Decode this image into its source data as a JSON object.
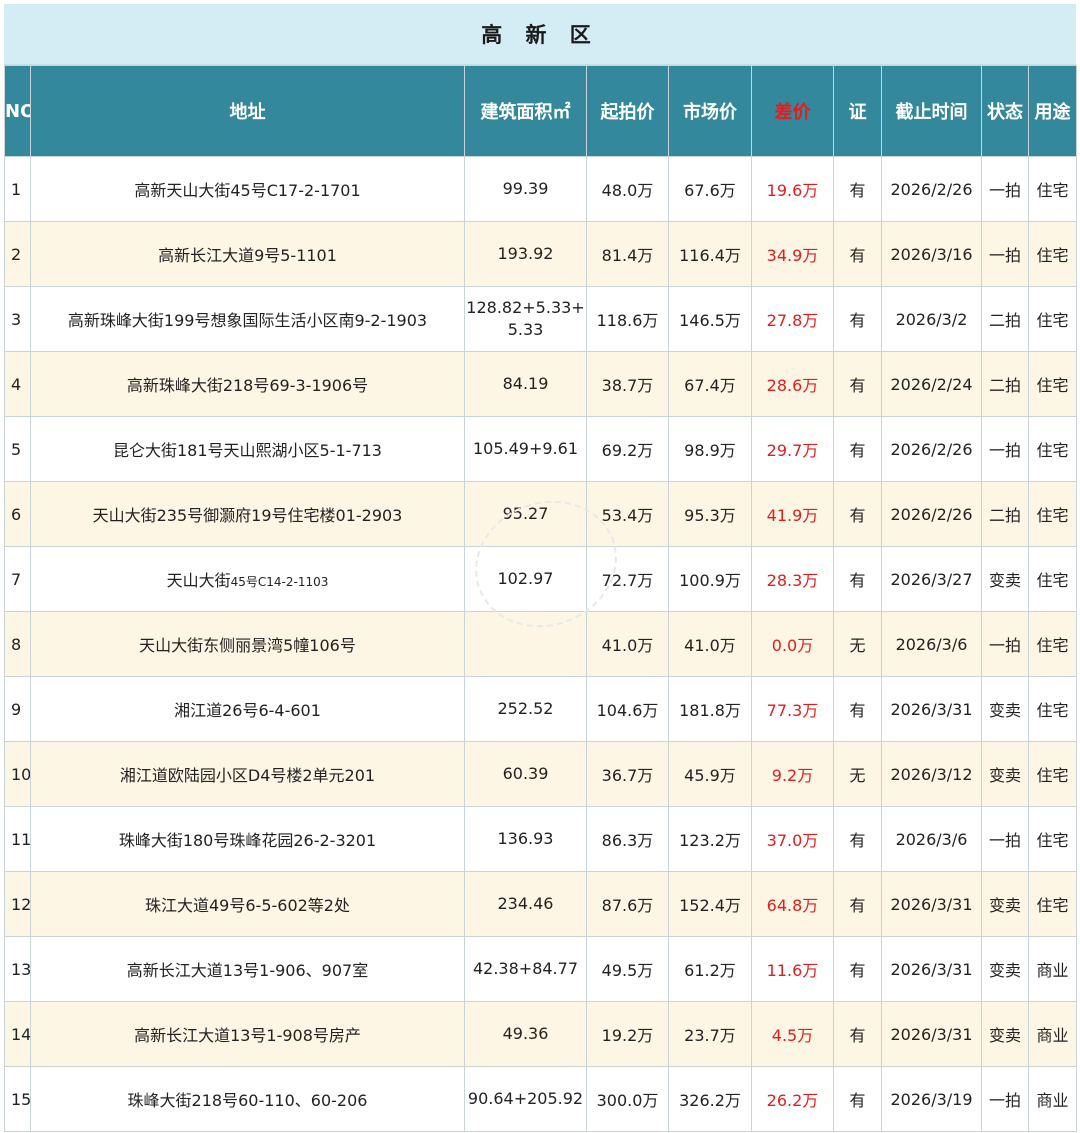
{
  "title": "高 新 区",
  "headers": {
    "no": "NO",
    "address": "地址",
    "area": "建筑面积㎡",
    "start_price": "起拍价",
    "market_price": "市场价",
    "diff": "差价",
    "cert": "证",
    "deadline": "截止时间",
    "status": "状态",
    "usage": "用途"
  },
  "rows": [
    {
      "no": "1",
      "address": "高新天山大街45号C17-2-1701",
      "area": "99.39",
      "start": "48.0万",
      "market": "67.6万",
      "diff": "19.6万",
      "cert": "有",
      "deadline": "2026/2/26",
      "status": "一拍",
      "usage": "住宅"
    },
    {
      "no": "2",
      "address": "高新长江大道9号5-1101",
      "area": "193.92",
      "start": "81.4万",
      "market": "116.4万",
      "diff": "34.9万",
      "cert": "有",
      "deadline": "2026/3/16",
      "status": "一拍",
      "usage": "住宅"
    },
    {
      "no": "3",
      "address": "高新珠峰大街199号想象国际生活小区南9-2-1903",
      "area": "128.82+5.33+\n5.33",
      "start": "118.6万",
      "market": "146.5万",
      "diff": "27.8万",
      "cert": "有",
      "deadline": "2026/3/2",
      "status": "二拍",
      "usage": "住宅"
    },
    {
      "no": "4",
      "address": "高新珠峰大街218号69-3-1906号",
      "area": "84.19",
      "start": "38.7万",
      "market": "67.4万",
      "diff": "28.6万",
      "cert": "有",
      "deadline": "2026/2/24",
      "status": "二拍",
      "usage": "住宅"
    },
    {
      "no": "5",
      "address": "昆仑大街181号天山熙湖小区5-1-713",
      "area": "105.49+9.61",
      "start": "69.2万",
      "market": "98.9万",
      "diff": "29.7万",
      "cert": "有",
      "deadline": "2026/2/26",
      "status": "一拍",
      "usage": "住宅"
    },
    {
      "no": "6",
      "address": "天山大街235号御灏府19号住宅楼01-2903",
      "area": "95.27",
      "start": "53.4万",
      "market": "95.3万",
      "diff": "41.9万",
      "cert": "有",
      "deadline": "2026/2/26",
      "status": "二拍",
      "usage": "住宅"
    },
    {
      "no": "7",
      "address_main": "天山大街",
      "address_small": "45号C14-2-1103",
      "area": "102.97",
      "start": "72.7万",
      "market": "100.9万",
      "diff": "28.3万",
      "cert": "有",
      "deadline": "2026/3/27",
      "status": "变卖",
      "usage": "住宅"
    },
    {
      "no": "8",
      "address": "天山大街东侧丽景湾5幢106号",
      "area": "",
      "start": "41.0万",
      "market": "41.0万",
      "diff": "0.0万",
      "cert": "无",
      "deadline": "2026/3/6",
      "status": "一拍",
      "usage": "住宅"
    },
    {
      "no": "9",
      "address": "湘江道26号6-4-601",
      "area": "252.52",
      "start": "104.6万",
      "market": "181.8万",
      "diff": "77.3万",
      "cert": "有",
      "deadline": "2026/3/31",
      "status": "变卖",
      "usage": "住宅"
    },
    {
      "no": "10",
      "address": "湘江道欧陆园小区D4号楼2单元201",
      "area": "60.39",
      "start": "36.7万",
      "market": "45.9万",
      "diff": "9.2万",
      "cert": "无",
      "deadline": "2026/3/12",
      "status": "变卖",
      "usage": "住宅"
    },
    {
      "no": "11",
      "address": "珠峰大街180号珠峰花园26-2-3201",
      "area": "136.93",
      "start": "86.3万",
      "market": "123.2万",
      "diff": "37.0万",
      "cert": "有",
      "deadline": "2026/3/6",
      "status": "一拍",
      "usage": "住宅"
    },
    {
      "no": "12",
      "address": "珠江大道49号6-5-602等2处",
      "area": "234.46",
      "start": "87.6万",
      "market": "152.4万",
      "diff": "64.8万",
      "cert": "有",
      "deadline": "2026/3/31",
      "status": "变卖",
      "usage": "住宅"
    },
    {
      "no": "13",
      "address": "高新长江大道13号1-906、907室",
      "area": "42.38+84.77",
      "start": "49.5万",
      "market": "61.2万",
      "diff": "11.6万",
      "cert": "有",
      "deadline": "2026/3/31",
      "status": "变卖",
      "usage": "商业"
    },
    {
      "no": "14",
      "address": "高新长江大道13号1-908号房产",
      "area": "49.36",
      "start": "19.2万",
      "market": "23.7万",
      "diff": "4.5万",
      "cert": "有",
      "deadline": "2026/3/31",
      "status": "变卖",
      "usage": "商业"
    },
    {
      "no": "15",
      "address": "珠峰大街218号60-110、60-206",
      "area": "90.64+205.92",
      "start": "300.0万",
      "market": "326.2万",
      "diff": "26.2万",
      "cert": "有",
      "deadline": "2026/3/19",
      "status": "一拍",
      "usage": "商业"
    }
  ],
  "watermark": "辉麟法拍"
}
